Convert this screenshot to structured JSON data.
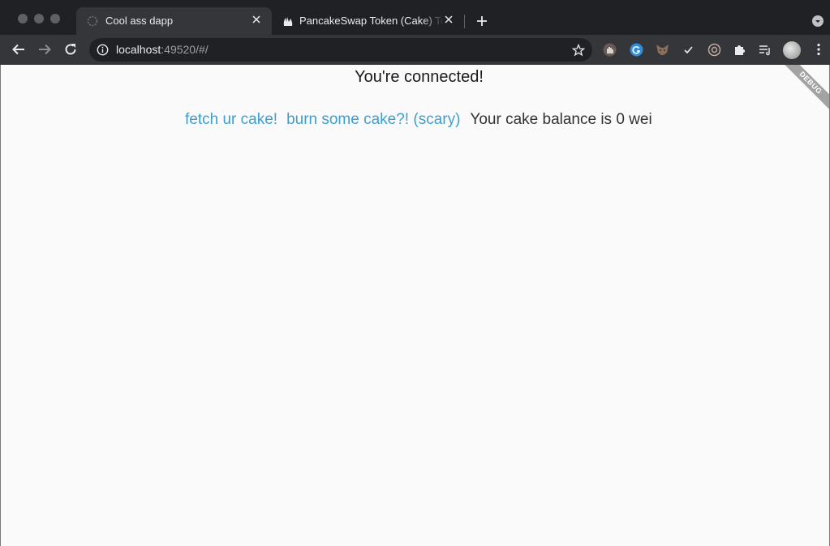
{
  "browser": {
    "tabs": [
      {
        "title": "Cool ass dapp",
        "active": true,
        "favicon": "loading-spinner-icon"
      },
      {
        "title": "PancakeSwap Token (Cake) Tok",
        "active": false,
        "favicon": "bunny-icon"
      }
    ],
    "address": {
      "host": "localhost",
      "rest": ":49520/#/"
    }
  },
  "page": {
    "heading": "You're connected!",
    "fetch_link": "fetch ur cake!",
    "burn_link": "burn some cake?! (scary)",
    "balance_text": "Your cake balance is 0 wei",
    "debug_banner": "DEBUG",
    "colors": {
      "link": "#3d9fd0",
      "background": "#fafafa"
    }
  }
}
